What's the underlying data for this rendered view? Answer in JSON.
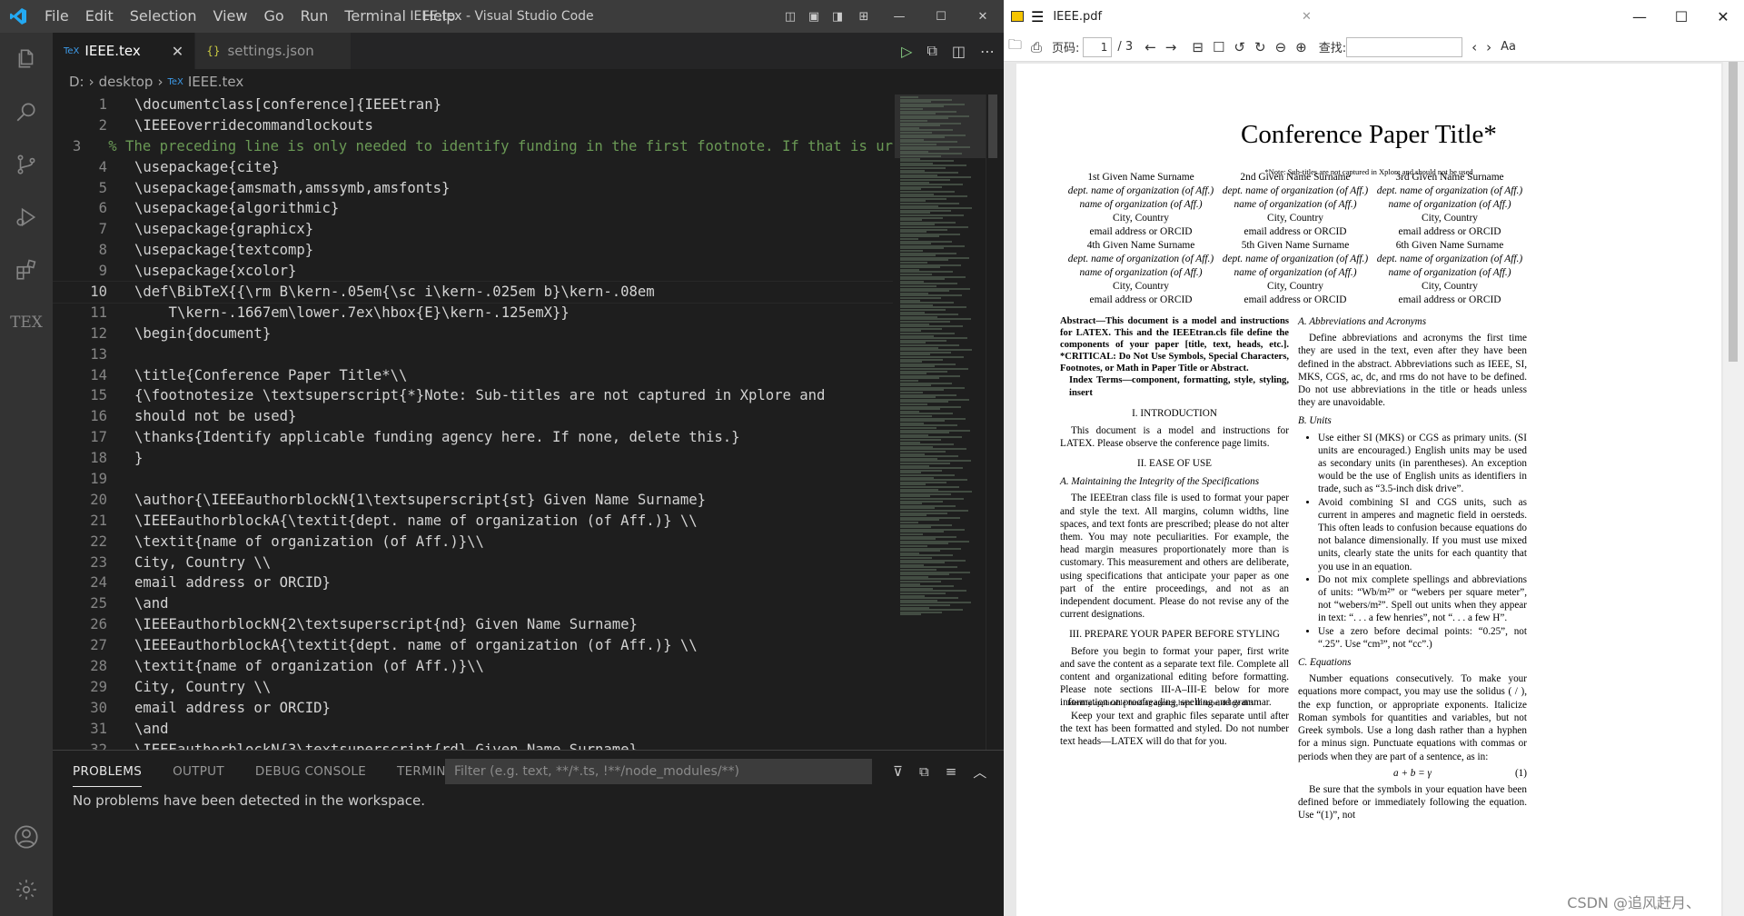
{
  "vscode": {
    "menu": [
      "File",
      "Edit",
      "Selection",
      "View",
      "Go",
      "Run",
      "Terminal",
      "Help"
    ],
    "window_title": "IEEE.tex - Visual Studio Code",
    "tabs": [
      {
        "label": "IEEE.tex",
        "icon": "TeX"
      },
      {
        "label": "settings.json",
        "icon": "{}"
      }
    ],
    "breadcrumb": [
      "D:",
      "desktop",
      "IEEE.tex"
    ],
    "activity_bottom_label": "TEX",
    "panel": {
      "tabs": [
        "PROBLEMS",
        "OUTPUT",
        "DEBUG CONSOLE",
        "TERMINAL"
      ],
      "filter_placeholder": "Filter (e.g. text, **/*.ts, !**/node_modules/**)",
      "message": "No problems have been detected in the workspace."
    },
    "code": [
      {
        "n": "1",
        "t": "\\documentclass[conference]{IEEEtran}"
      },
      {
        "n": "2",
        "t": "\\IEEEoverridecommandlockouts"
      },
      {
        "n": "3",
        "t": "% The preceding line is only needed to identify funding in the first footnote. If that is ur"
      },
      {
        "n": "4",
        "t": "\\usepackage{cite}"
      },
      {
        "n": "5",
        "t": "\\usepackage{amsmath,amssymb,amsfonts}"
      },
      {
        "n": "6",
        "t": "\\usepackage{algorithmic}"
      },
      {
        "n": "7",
        "t": "\\usepackage{graphicx}"
      },
      {
        "n": "8",
        "t": "\\usepackage{textcomp}"
      },
      {
        "n": "9",
        "t": "\\usepackage{xcolor}"
      },
      {
        "n": "10",
        "t": "\\def\\BibTeX{{\\rm B\\kern-.05em{\\sc i\\kern-.025em b}\\kern-.08em"
      },
      {
        "n": "11",
        "t": "    T\\kern-.1667em\\lower.7ex\\hbox{E}\\kern-.125emX}}"
      },
      {
        "n": "12",
        "t": "\\begin{document}"
      },
      {
        "n": "13",
        "t": ""
      },
      {
        "n": "14",
        "t": "\\title{Conference Paper Title*\\\\"
      },
      {
        "n": "15",
        "t": "{\\footnotesize \\textsuperscript{*}Note: Sub-titles are not captured in Xplore and"
      },
      {
        "n": "16",
        "t": "should not be used}"
      },
      {
        "n": "17",
        "t": "\\thanks{Identify applicable funding agency here. If none, delete this.}"
      },
      {
        "n": "18",
        "t": "}"
      },
      {
        "n": "19",
        "t": ""
      },
      {
        "n": "20",
        "t": "\\author{\\IEEEauthorblockN{1\\textsuperscript{st} Given Name Surname}"
      },
      {
        "n": "21",
        "t": "\\IEEEauthorblockA{\\textit{dept. name of organization (of Aff.)} \\\\"
      },
      {
        "n": "22",
        "t": "\\textit{name of organization (of Aff.)}\\\\"
      },
      {
        "n": "23",
        "t": "City, Country \\\\"
      },
      {
        "n": "24",
        "t": "email address or ORCID}"
      },
      {
        "n": "25",
        "t": "\\and"
      },
      {
        "n": "26",
        "t": "\\IEEEauthorblockN{2\\textsuperscript{nd} Given Name Surname}"
      },
      {
        "n": "27",
        "t": "\\IEEEauthorblockA{\\textit{dept. name of organization (of Aff.)} \\\\"
      },
      {
        "n": "28",
        "t": "\\textit{name of organization (of Aff.)}\\\\"
      },
      {
        "n": "29",
        "t": "City, Country \\\\"
      },
      {
        "n": "30",
        "t": "email address or ORCID}"
      },
      {
        "n": "31",
        "t": "\\and"
      },
      {
        "n": "32",
        "t": "\\IEEEauthorblockN{3\\textsuperscript{rd} Given Name Surname}"
      }
    ]
  },
  "pdf": {
    "file": "IEEE.pdf",
    "page_label": "页码:",
    "page_current": "1",
    "page_total": "/ 3",
    "find_label": "查找:",
    "title": "Conference Paper Title*",
    "note": "*Note: Sub-titles are not captured in Xplore and should not be used",
    "authors": [
      {
        "name": "1st Given Name Surname",
        "dept": "dept. name of organization (of Aff.)",
        "org": "name of organization (of Aff.)",
        "city": "City, Country",
        "email": "email address or ORCID"
      },
      {
        "name": "2nd Given Name Surname",
        "dept": "dept. name of organization (of Aff.)",
        "org": "name of organization (of Aff.)",
        "city": "City, Country",
        "email": "email address or ORCID"
      },
      {
        "name": "3rd Given Name Surname",
        "dept": "dept. name of organization (of Aff.)",
        "org": "name of organization (of Aff.)",
        "city": "City, Country",
        "email": "email address or ORCID"
      },
      {
        "name": "4th Given Name Surname",
        "dept": "dept. name of organization (of Aff.)",
        "org": "name of organization (of Aff.)",
        "city": "City, Country",
        "email": "email address or ORCID"
      },
      {
        "name": "5th Given Name Surname",
        "dept": "dept. name of organization (of Aff.)",
        "org": "name of organization (of Aff.)",
        "city": "City, Country",
        "email": "email address or ORCID"
      },
      {
        "name": "6th Given Name Surname",
        "dept": "dept. name of organization (of Aff.)",
        "org": "name of organization (of Aff.)",
        "city": "City, Country",
        "email": "email address or ORCID"
      }
    ],
    "abstract": "Abstract—This document is a model and instructions for LATEX. This and the IEEEtran.cls file define the components of your paper [title, text, heads, etc.]. *CRITICAL: Do Not Use Symbols, Special Characters, Footnotes, or Math in Paper Title or Abstract.",
    "index_terms": "Index Terms—component, formatting, style, styling, insert",
    "s1": "I. INTRODUCTION",
    "s1p": "This document is a model and instructions for LATEX. Please observe the conference page limits.",
    "s2": "II. EASE OF USE",
    "s2a": "A. Maintaining the Integrity of the Specifications",
    "s2ap": "The IEEEtran class file is used to format your paper and style the text. All margins, column widths, line spaces, and text fonts are prescribed; please do not alter them. You may note peculiarities. For example, the head margin measures proportionately more than is customary. This measurement and others are deliberate, using specifications that anticipate your paper as one part of the entire proceedings, and not as an independent document. Please do not revise any of the current designations.",
    "s3": "III. PREPARE YOUR PAPER BEFORE STYLING",
    "s3p1": "Before you begin to format your paper, first write and save the content as a separate text file. Complete all content and organizational editing before formatting. Please note sections III-A–III-E below for more information on proofreading, spelling and grammar.",
    "s3p2": "Keep your text and graphic files separate until after the text has been formatted and styled. Do not number text heads—LATEX will do that for you.",
    "footnote": "Identify applicable funding agency here. If none, delete this.",
    "r_a": "A. Abbreviations and Acronyms",
    "r_ap": "Define abbreviations and acronyms the first time they are used in the text, even after they have been defined in the abstract. Abbreviations such as IEEE, SI, MKS, CGS, ac, dc, and rms do not have to be defined. Do not use abbreviations in the title or heads unless they are unavoidable.",
    "r_b": "B. Units",
    "r_bl": [
      "Use either SI (MKS) or CGS as primary units. (SI units are encouraged.) English units may be used as secondary units (in parentheses). An exception would be the use of English units as identifiers in trade, such as “3.5-inch disk drive”.",
      "Avoid combining SI and CGS units, such as current in amperes and magnetic field in oersteds. This often leads to confusion because equations do not balance dimensionally. If you must use mixed units, clearly state the units for each quantity that you use in an equation.",
      "Do not mix complete spellings and abbreviations of units: “Wb/m²” or “webers per square meter”, not “webers/m²”. Spell out units when they appear in text: “. . . a few henries”, not “. . . a few H”.",
      "Use a zero before decimal points: “0.25”, not “.25”. Use “cm³”, not “cc”.)"
    ],
    "r_c": "C. Equations",
    "r_cp": "Number equations consecutively. To make your equations more compact, you may use the solidus ( / ), the exp function, or appropriate exponents. Italicize Roman symbols for quantities and variables, but not Greek symbols. Use a long dash rather than a hyphen for a minus sign. Punctuate equations with commas or periods when they are part of a sentence, as in:",
    "eq": "a + b = γ",
    "eqn": "(1)",
    "r_cp2": "Be sure that the symbols in your equation have been defined before or immediately following the equation. Use “(1)”, not",
    "watermark": "CSDN @追风赶月、"
  }
}
